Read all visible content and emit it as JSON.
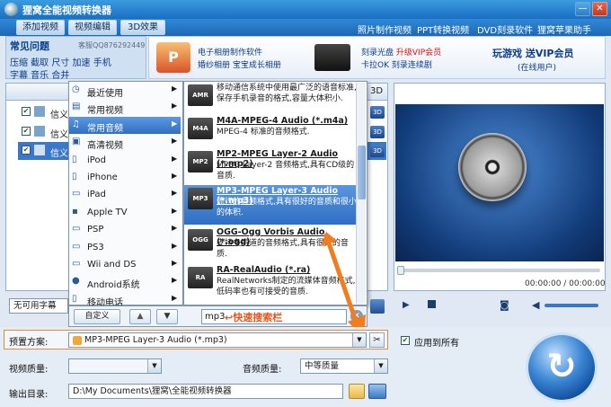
{
  "window": {
    "title": "狸窝全能视频转换器",
    "min": "—",
    "close": "✕"
  },
  "toolbar": {
    "add_video": "添加视频",
    "edit_video": "视频编辑",
    "effect_3d": "3D效果",
    "links": [
      "照片制作视频",
      "PPT转换视频",
      "DVD刻录软件",
      "狸窝苹果助手"
    ]
  },
  "faq": {
    "title": "常见问题",
    "qq": "客服QQ876292449",
    "line1": "压缩 截取 尺寸 加速 手机",
    "line2": "字幕 音乐 合并"
  },
  "ads": {
    "a1_l1": "电子相册制作软件",
    "a1_l2": "婚纱相册 宝宝成长相册",
    "a2_l1": "刻录光盘",
    "a2_l1_red": "升级VIP会员",
    "a2_l2": "卡拉OK 刻录连续剧",
    "a3_l1": "玩游戏 送VIP会员",
    "a3_l2": "(在线用户)"
  },
  "list": {
    "header_3d": "3D",
    "rows": [
      {
        "name": "信义",
        "badge": "3D"
      },
      {
        "name": "信义",
        "badge": "3D"
      },
      {
        "name": "信义",
        "badge": "3D"
      }
    ],
    "subtitle_label": "无可用字幕"
  },
  "menu": {
    "categories": [
      {
        "label": "最近使用",
        "icon": "clock-icon"
      },
      {
        "label": "常用视频",
        "icon": "film-icon"
      },
      {
        "label": "常用音频",
        "icon": "music-icon"
      },
      {
        "label": "高清视频",
        "icon": "hd-icon"
      },
      {
        "label": "iPod",
        "icon": "ipod-icon"
      },
      {
        "label": "iPhone",
        "icon": "iphone-icon"
      },
      {
        "label": "iPad",
        "icon": "ipad-icon"
      },
      {
        "label": "Apple TV",
        "icon": "appletv-icon"
      },
      {
        "label": "PSP",
        "icon": "psp-icon"
      },
      {
        "label": "PS3",
        "icon": "ps3-icon"
      },
      {
        "label": "Wii and DS",
        "icon": "wii-icon"
      },
      {
        "label": "Android系统",
        "icon": "android-icon"
      },
      {
        "label": "移动电话",
        "icon": "phone-icon"
      }
    ],
    "selected_category": 2,
    "formats": [
      {
        "badge": "AMR",
        "name": "",
        "desc": "移动通信系统中使用最广泛的语音标准,保存手机录音的格式,容量大体积小."
      },
      {
        "badge": "M4A",
        "name": "M4A-MPEG-4 Audio (*.m4a)",
        "desc": "MPEG-4 标准的音频格式."
      },
      {
        "badge": "MP2",
        "name": "MP2-MPEG Layer-2 Audio (*.mp2)",
        "desc": "MPEG Layer-2 音频格式,具有CD级的音质."
      },
      {
        "badge": "MP3",
        "name": "MP3-MPEG Layer-3 Audio (*.mp3)",
        "desc": "流行的音频格式,具有很好的音质和很小的体积."
      },
      {
        "badge": "OGG",
        "name": "OGG-Ogg Vorbis Audio (*.ogg)",
        "desc": "支持多声道的音频格式,具有很好的音质."
      },
      {
        "badge": "RA",
        "name": "RA-RealAudio (*.ra)",
        "desc": "RealNetworks制定的流媒体音频格式,低码率也有可接受的音质."
      }
    ],
    "selected_format": 3,
    "customize": "自定义",
    "search_value": "mp3",
    "search_hint": "快速搜索栏"
  },
  "form": {
    "preset_label": "预置方案:",
    "preset_value": "MP3-MPEG Layer-3 Audio (*.mp3)",
    "apply_all": "应用到所有",
    "video_quality_label": "视频质量:",
    "audio_quality_label": "音频质量:",
    "audio_quality_value": "中等质量",
    "output_label": "输出目录:",
    "output_value": "D:\\My Documents\\狸窝\\全能视频转换器"
  },
  "player": {
    "time": "00:00:00 / 00:00:00"
  },
  "colors": {
    "accent": "#2f6fc2",
    "hint": "#e8541b"
  }
}
